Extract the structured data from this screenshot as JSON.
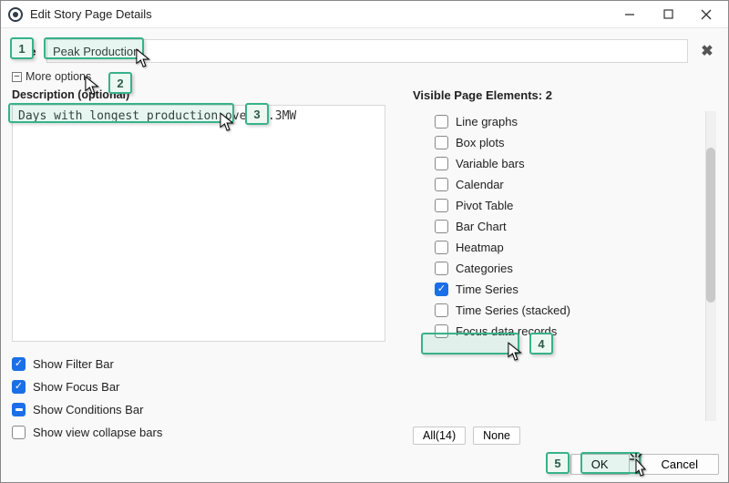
{
  "window": {
    "title": "Edit Story Page Details"
  },
  "form": {
    "title_label": "Title",
    "title_value": "Peak Production",
    "more_options_label": "More options",
    "description_label": "Description (optional)",
    "description_value": "Days with longest production over 0.3MW"
  },
  "left_checks": [
    {
      "label": "Show Filter Bar",
      "state": "checked"
    },
    {
      "label": "Show Focus Bar",
      "state": "checked"
    },
    {
      "label": "Show Conditions Bar",
      "state": "indeterminate"
    },
    {
      "label": "Show view collapse bars",
      "state": "unchecked"
    }
  ],
  "right": {
    "heading": "Visible Page Elements: 2",
    "items": [
      {
        "label": "Line graphs",
        "checked": false
      },
      {
        "label": "Box plots",
        "checked": false
      },
      {
        "label": "Variable bars",
        "checked": false
      },
      {
        "label": "Calendar",
        "checked": false
      },
      {
        "label": "Pivot Table",
        "checked": false
      },
      {
        "label": "Bar Chart",
        "checked": false
      },
      {
        "label": "Heatmap",
        "checked": false
      },
      {
        "label": "Categories",
        "checked": false
      },
      {
        "label": "Time Series",
        "checked": true
      },
      {
        "label": "Time Series (stacked)",
        "checked": false
      },
      {
        "label": "Focus data records",
        "checked": false
      }
    ],
    "all_button": "All(14)",
    "none_button": "None"
  },
  "footer": {
    "ok": "OK",
    "cancel": "Cancel"
  },
  "steps": {
    "s1": "1",
    "s2": "2",
    "s3": "3",
    "s4": "4",
    "s5": "5"
  }
}
